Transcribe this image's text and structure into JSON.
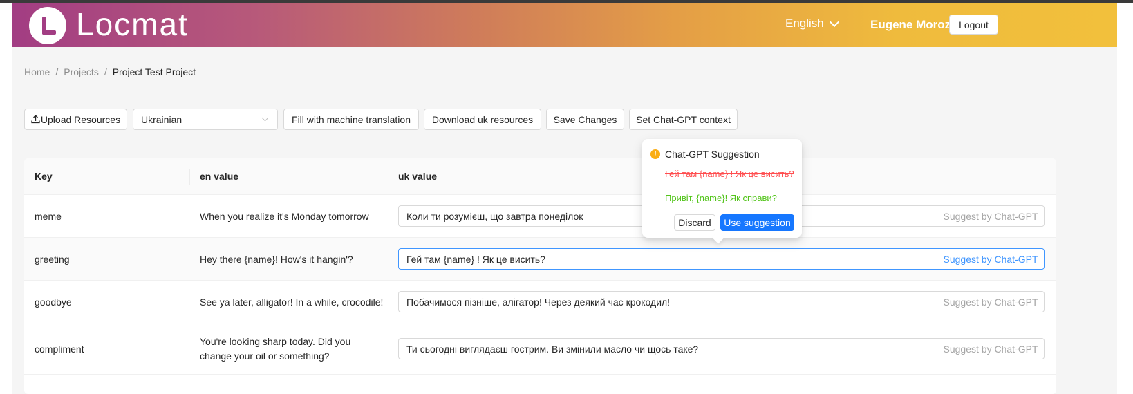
{
  "header": {
    "logo_text": "Locmat",
    "language": "English",
    "user_name": "Eugene Moroz",
    "logout_label": "Logout",
    "gradient": [
      "#a23d83",
      "#cf7c5a",
      "#f2c03c"
    ]
  },
  "breadcrumb": {
    "items": [
      "Home",
      "Projects",
      "Project Test Project"
    ],
    "separator": "/"
  },
  "toolbar": {
    "upload_label": "Upload Resources",
    "language_select": "Ukrainian",
    "fill_label": "Fill with machine translation",
    "download_label": "Download uk resources",
    "save_label": "Save Changes",
    "context_label": "Set Chat-GPT context"
  },
  "table": {
    "columns": [
      "Key",
      "en value",
      "uk value"
    ],
    "suggest_label": "Suggest by Chat-GPT",
    "rows": [
      {
        "key": "meme",
        "en": "When you realize it's Monday tomorrow",
        "uk": "Коли ти розумієш, що завтра понеділок"
      },
      {
        "key": "greeting",
        "en": "Hey there {name}! How's it hangin'?",
        "uk": "Гей там {name} ! Як це висить?"
      },
      {
        "key": "goodbye",
        "en": "See ya later, alligator! In a while, crocodile!",
        "uk": "Побачимося пізніше, алігатор! Через деякий час крокодил!"
      },
      {
        "key": "compliment",
        "en_line1": "You're looking sharp today. Did you",
        "en_line2": "change your oil or something?",
        "uk": "Ти сьогодні виглядаєш гострим. Ви змінили масло чи щось таке?"
      }
    ]
  },
  "popover": {
    "title": "Chat-GPT Suggestion",
    "old_text": "Гей там {name} ! Як це висить?",
    "new_text": "Привіт, {name}! Як справи?",
    "discard_label": "Discard",
    "use_label": "Use suggestion"
  },
  "colors": {
    "primary": "#1677ff",
    "removed": "#ff4d4f",
    "added": "#52c41a",
    "warning": "#faad14"
  }
}
